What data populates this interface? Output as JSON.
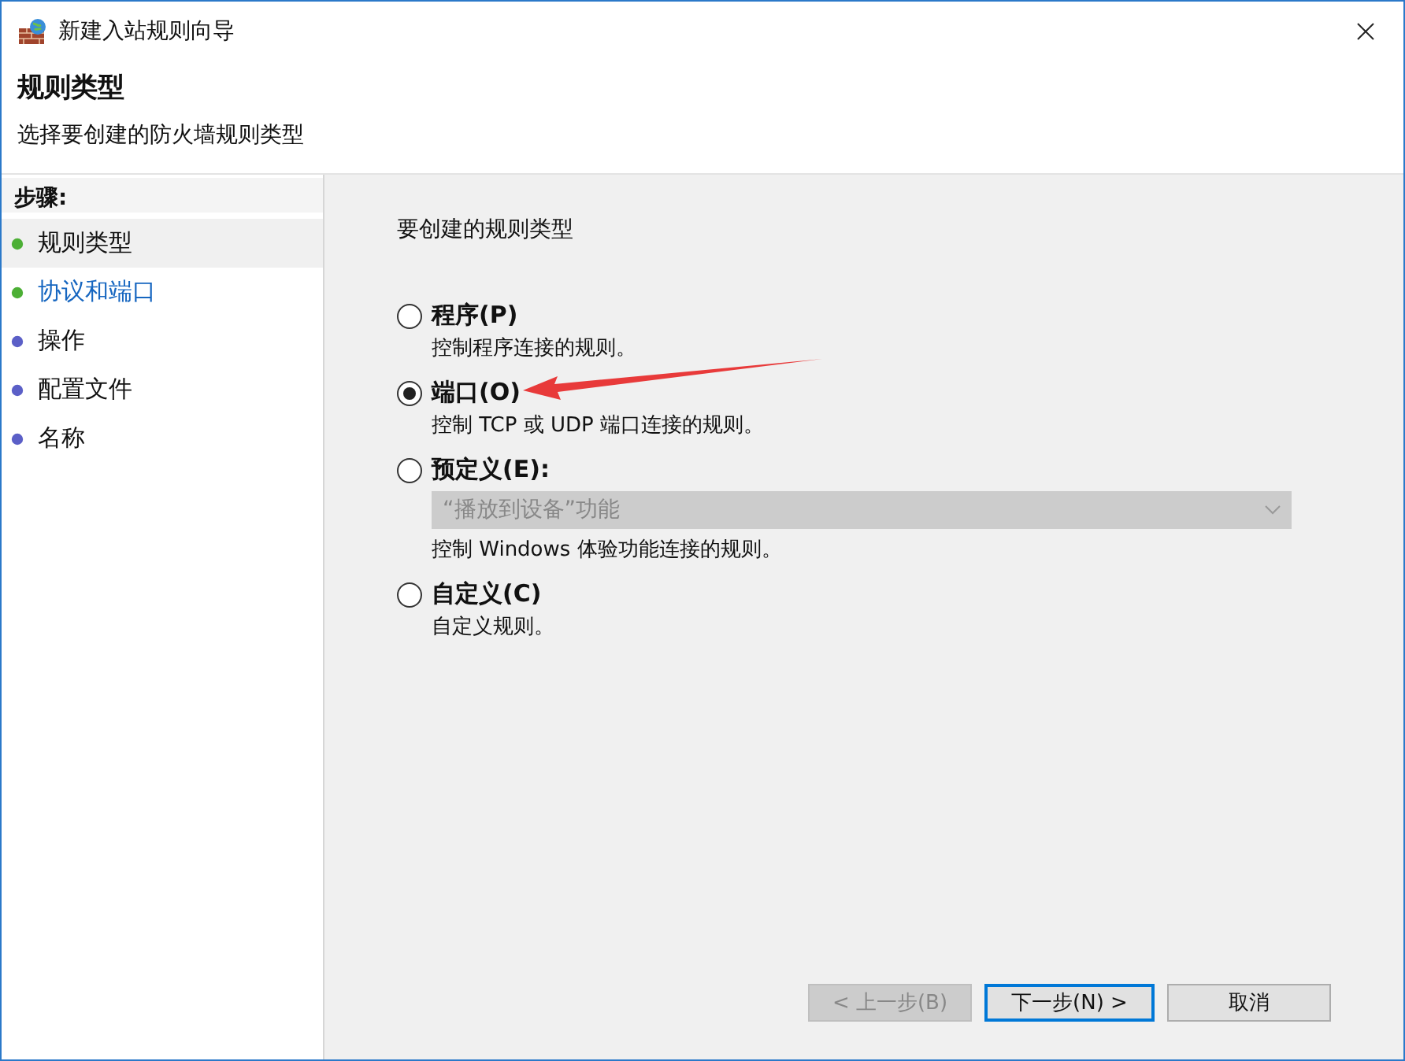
{
  "window": {
    "title": "新建入站规则向导"
  },
  "header": {
    "title": "规则类型",
    "subtitle": "选择要创建的防火墙规则类型"
  },
  "steps": {
    "heading": "步骤:",
    "items": [
      {
        "label": "规则类型",
        "completed": true,
        "selected": true,
        "hovered": false
      },
      {
        "label": "协议和端口",
        "completed": true,
        "selected": false,
        "hovered": true
      },
      {
        "label": "操作",
        "completed": false,
        "selected": false,
        "hovered": false
      },
      {
        "label": "配置文件",
        "completed": false,
        "selected": false,
        "hovered": false
      },
      {
        "label": "名称",
        "completed": false,
        "selected": false,
        "hovered": false
      }
    ]
  },
  "content": {
    "prompt": "要创建的规则类型",
    "options": [
      {
        "label": "程序(P)",
        "description": "控制程序连接的规则。",
        "selected": false
      },
      {
        "label": "端口(O)",
        "description": "控制 TCP 或 UDP 端口连接的规则。",
        "selected": true,
        "annotated": true
      },
      {
        "label": "预定义(E):",
        "dropdown": {
          "value": "“播放到设备”功能",
          "disabled": true
        },
        "description": "控制 Windows 体验功能连接的规则。",
        "selected": false
      },
      {
        "label": "自定义(C)",
        "description": "自定义规则。",
        "selected": false
      }
    ]
  },
  "buttons": [
    {
      "label": "< 上一步(B)",
      "disabled": true,
      "default": false
    },
    {
      "label": "下一步(N) >",
      "disabled": false,
      "default": true
    },
    {
      "label": "取消",
      "disabled": false,
      "default": false
    }
  ]
}
